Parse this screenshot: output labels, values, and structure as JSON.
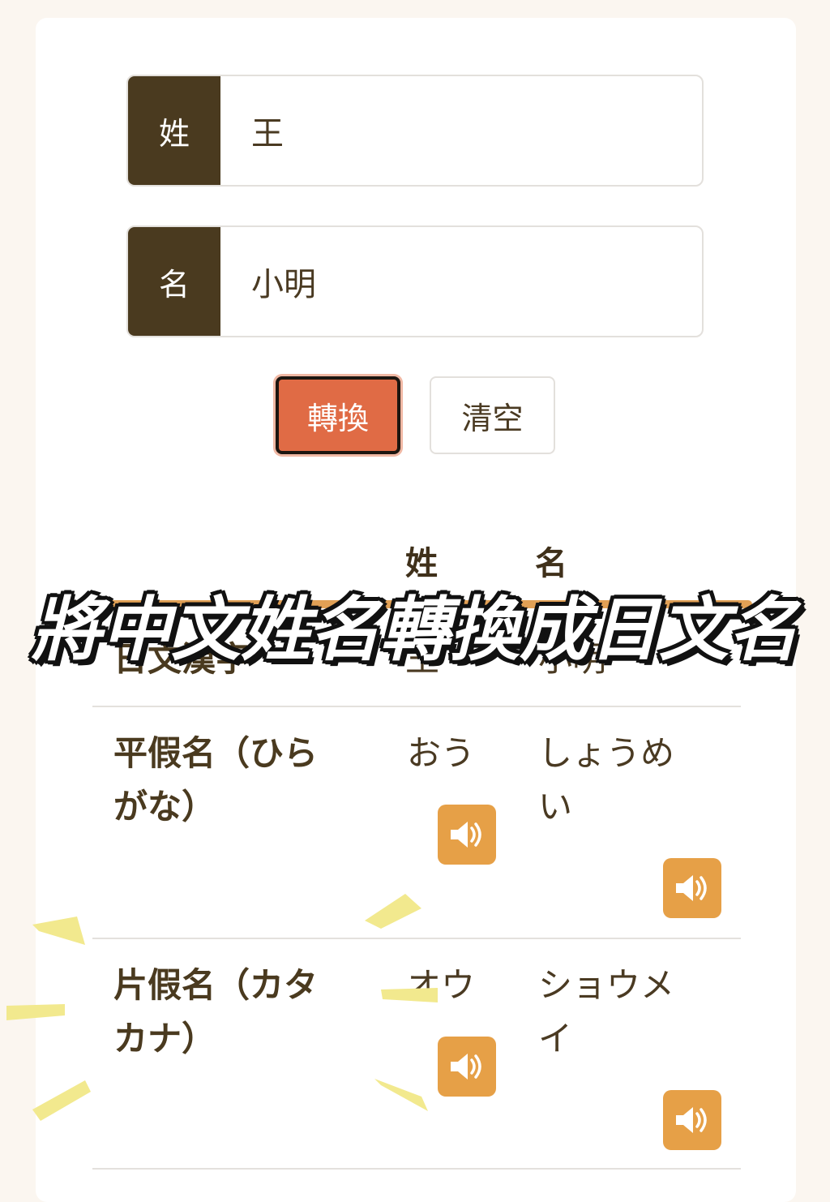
{
  "form": {
    "surname_label": "姓",
    "surname_value": "王",
    "given_label": "名",
    "given_value": "小明"
  },
  "buttons": {
    "convert": "轉換",
    "clear": "清空"
  },
  "result": {
    "col_surname": "姓",
    "col_given": "名",
    "rows": [
      {
        "label": "日文漢字",
        "surname": "王",
        "given": "小明"
      },
      {
        "label_line1": "平假名（ひら",
        "label_line2": "がな）",
        "surname": "おう",
        "given_line1": "しょうめ",
        "given_line2": "い"
      },
      {
        "label_line1": "片假名（カタ",
        "label_line2": "カナ）",
        "surname": "オウ",
        "given_line1": "ショウメ",
        "given_line2": "イ"
      }
    ]
  },
  "overlay": {
    "title": "將中文姓名轉換成日文名"
  },
  "icons": {
    "speaker": "speaker-icon"
  },
  "colors": {
    "label_bg": "#4a3a1f",
    "convert_bg": "#e06b45",
    "speaker_bg": "#e6a047"
  }
}
